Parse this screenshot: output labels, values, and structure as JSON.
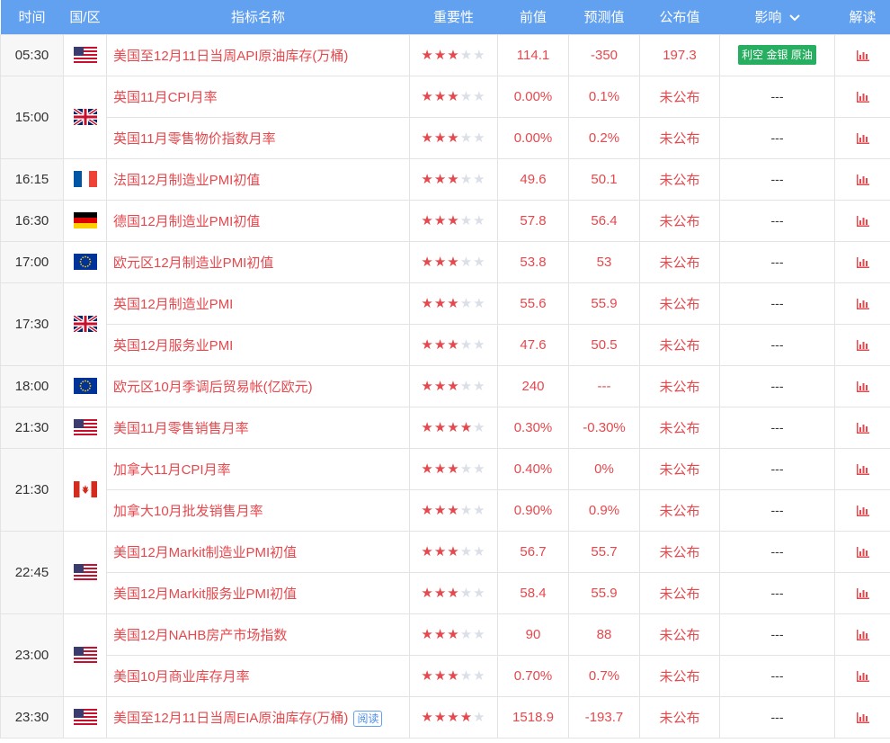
{
  "header": {
    "time": "时间",
    "country": "国/区",
    "name": "指标名称",
    "importance": "重要性",
    "prev": "前值",
    "forecast": "预测值",
    "actual": "公布值",
    "impact": "影响",
    "interpret": "解读"
  },
  "colors": {
    "header_bg": "#62a0f0",
    "accent_red": "#e5484d",
    "badge_green": "#27ae60"
  },
  "groups": [
    {
      "time": "05:30",
      "flag": "us",
      "rows": [
        {
          "name": "美国至12月11日当周API原油库存(万桶)",
          "stars": 3,
          "prev": "114.1",
          "forecast": "-350",
          "actual": "197.3",
          "impact": "利空 金银 原油",
          "impact_badge": true
        }
      ]
    },
    {
      "time": "15:00",
      "flag": "uk",
      "rows": [
        {
          "name": "英国11月CPI月率",
          "stars": 3,
          "prev": "0.00%",
          "forecast": "0.1%",
          "actual": "未公布",
          "impact": "---"
        },
        {
          "name": "英国11月零售物价指数月率",
          "stars": 3,
          "prev": "0.00%",
          "forecast": "0.2%",
          "actual": "未公布",
          "impact": "---"
        }
      ]
    },
    {
      "time": "16:15",
      "flag": "fr",
      "rows": [
        {
          "name": "法国12月制造业PMI初值",
          "stars": 3,
          "prev": "49.6",
          "forecast": "50.1",
          "actual": "未公布",
          "impact": "---"
        }
      ]
    },
    {
      "time": "16:30",
      "flag": "de",
      "rows": [
        {
          "name": "德国12月制造业PMI初值",
          "stars": 3,
          "prev": "57.8",
          "forecast": "56.4",
          "actual": "未公布",
          "impact": "---"
        }
      ]
    },
    {
      "time": "17:00",
      "flag": "eu",
      "rows": [
        {
          "name": "欧元区12月制造业PMI初值",
          "stars": 3,
          "prev": "53.8",
          "forecast": "53",
          "actual": "未公布",
          "impact": "---"
        }
      ]
    },
    {
      "time": "17:30",
      "flag": "uk",
      "rows": [
        {
          "name": "英国12月制造业PMI",
          "stars": 3,
          "prev": "55.6",
          "forecast": "55.9",
          "actual": "未公布",
          "impact": "---"
        },
        {
          "name": "英国12月服务业PMI",
          "stars": 3,
          "prev": "47.6",
          "forecast": "50.5",
          "actual": "未公布",
          "impact": "---"
        }
      ]
    },
    {
      "time": "18:00",
      "flag": "eu",
      "rows": [
        {
          "name": "欧元区10月季调后贸易帐(亿欧元)",
          "stars": 3,
          "prev": "240",
          "forecast": "---",
          "actual": "未公布",
          "impact": "---"
        }
      ]
    },
    {
      "time": "21:30",
      "flag": "us",
      "rows": [
        {
          "name": "美国11月零售销售月率",
          "stars": 4,
          "prev": "0.30%",
          "forecast": "-0.30%",
          "actual": "未公布",
          "impact": "---"
        }
      ]
    },
    {
      "time": "21:30",
      "flag": "ca",
      "rows": [
        {
          "name": "加拿大11月CPI月率",
          "stars": 3,
          "prev": "0.40%",
          "forecast": "0%",
          "actual": "未公布",
          "impact": "---"
        },
        {
          "name": "加拿大10月批发销售月率",
          "stars": 3,
          "prev": "0.90%",
          "forecast": "0.9%",
          "actual": "未公布",
          "impact": "---"
        }
      ]
    },
    {
      "time": "22:45",
      "flag": "us",
      "rows": [
        {
          "name": "美国12月Markit制造业PMI初值",
          "stars": 3,
          "prev": "56.7",
          "forecast": "55.7",
          "actual": "未公布",
          "impact": "---"
        },
        {
          "name": "美国12月Markit服务业PMI初值",
          "stars": 3,
          "prev": "58.4",
          "forecast": "55.9",
          "actual": "未公布",
          "impact": "---"
        }
      ]
    },
    {
      "time": "23:00",
      "flag": "us",
      "rows": [
        {
          "name": "美国12月NAHB房产市场指数",
          "stars": 3,
          "prev": "90",
          "forecast": "88",
          "actual": "未公布",
          "impact": "---"
        },
        {
          "name": "美国10月商业库存月率",
          "stars": 3,
          "prev": "0.70%",
          "forecast": "0.7%",
          "actual": "未公布",
          "impact": "---"
        }
      ]
    },
    {
      "time": "23:30",
      "flag": "us",
      "rows": [
        {
          "name": "美国至12月11日当周EIA原油库存(万桶)",
          "tag": "阅读",
          "stars": 4,
          "prev": "1518.9",
          "forecast": "-193.7",
          "actual": "未公布",
          "impact": "---"
        }
      ]
    }
  ]
}
